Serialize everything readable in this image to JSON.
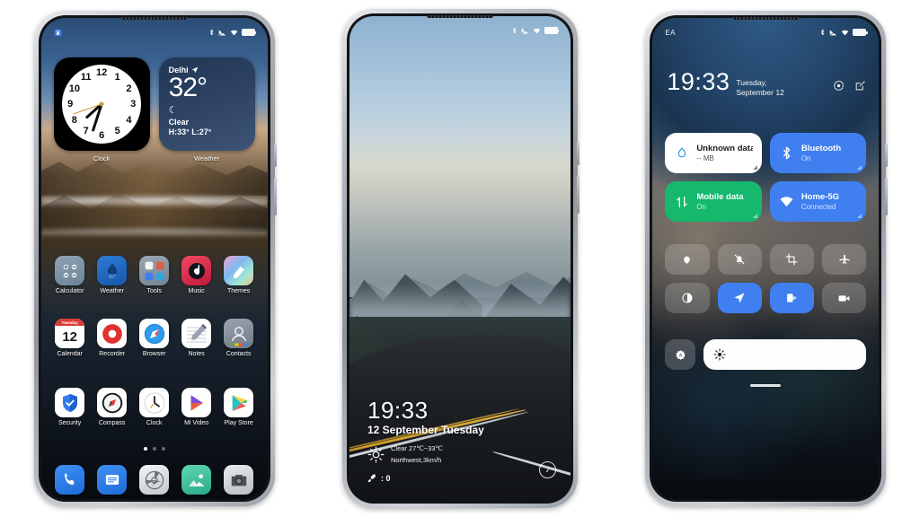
{
  "meta": {
    "scene": "Three smartphone mockups showing MIUI-style home screen, lock screen and control center"
  },
  "phone1": {
    "name": "home-screen",
    "statusbar": {
      "carrier": "",
      "icons": [
        "bluetooth-icon",
        "signal-icon",
        "wifi-icon",
        "battery-icon"
      ]
    },
    "widgets": [
      {
        "type": "clock",
        "label": "Clock",
        "numbers": [
          "12",
          "1",
          "2",
          "3",
          "4",
          "5",
          "6",
          "7",
          "8",
          "9",
          "10",
          "11"
        ],
        "hour_deg": 228,
        "minute_deg": 198,
        "second_deg": 251
      },
      {
        "type": "weather",
        "label": "Weather",
        "city": "Delhi",
        "temp": "32°",
        "condition": "Clear",
        "highlow": "H:33° L:27°",
        "moon_glyph": "☾"
      }
    ],
    "app_rows": [
      [
        {
          "label": "Calculator",
          "icon": "calculator-icon"
        },
        {
          "label": "Weather",
          "icon": "weather-icon"
        },
        {
          "label": "Tools",
          "icon": "tools-folder-icon"
        },
        {
          "label": "Music",
          "icon": "music-icon"
        },
        {
          "label": "Themes",
          "icon": "themes-icon"
        }
      ],
      [
        {
          "label": "Calendar",
          "icon": "calendar-icon",
          "day": "12",
          "weekday": "Tuesday"
        },
        {
          "label": "Recorder",
          "icon": "recorder-icon"
        },
        {
          "label": "Browser",
          "icon": "browser-icon"
        },
        {
          "label": "Notes",
          "icon": "notes-icon"
        },
        {
          "label": "Contacts",
          "icon": "contacts-icon"
        }
      ],
      [
        {
          "label": "Security",
          "icon": "security-icon"
        },
        {
          "label": "Compass",
          "icon": "compass-icon"
        },
        {
          "label": "Clock",
          "icon": "clock-app-icon"
        },
        {
          "label": "Mi Video",
          "icon": "mi-video-icon"
        },
        {
          "label": "Play Store",
          "icon": "play-store-icon"
        }
      ]
    ],
    "page_dots": {
      "count": 3,
      "active": 0
    },
    "dock": [
      {
        "label": "Phone",
        "icon": "phone-icon"
      },
      {
        "label": "Messages",
        "icon": "messages-icon"
      },
      {
        "label": "Settings",
        "icon": "settings-icon"
      },
      {
        "label": "Gallery",
        "icon": "gallery-icon"
      },
      {
        "label": "Camera",
        "icon": "camera-icon"
      }
    ]
  },
  "phone2": {
    "name": "lock-screen",
    "statusbar": {
      "icons": [
        "bluetooth-icon",
        "signal-icon",
        "wifi-icon",
        "battery-icon"
      ]
    },
    "time": "19:33",
    "date": "12 September Tuesday",
    "weather_line1": "Clear 27℃~33℃",
    "weather_line2": "Northwest,3km/h",
    "steps": ": 0",
    "music_glyph": "♪"
  },
  "phone3": {
    "name": "control-center",
    "statusbar": {
      "carrier": "EA",
      "icons": [
        "bluetooth-icon",
        "signal-icon",
        "wifi-icon",
        "battery-icon"
      ]
    },
    "time": "19:33",
    "date": "Tuesday, September 12",
    "actions": [
      {
        "name": "settings-gear-icon"
      },
      {
        "name": "edit-icon"
      }
    ],
    "tiles": [
      {
        "title": "Unknown data plan",
        "subtitle": "-- MB",
        "icon": "data-drop-icon",
        "style": "white"
      },
      {
        "title": "Bluetooth",
        "subtitle": "On",
        "icon": "bluetooth-icon",
        "style": "blue"
      },
      {
        "title": "Mobile data",
        "subtitle": "On",
        "icon": "mobile-data-icon",
        "style": "green"
      },
      {
        "title": "Home-5G",
        "subtitle": "Connected",
        "icon": "wifi-icon",
        "style": "blue"
      }
    ],
    "toggles": [
      {
        "name": "flashlight-toggle",
        "icon": "flashlight-icon",
        "on": false
      },
      {
        "name": "silent-toggle",
        "icon": "bell-muted-icon",
        "on": false
      },
      {
        "name": "screenshot-toggle",
        "icon": "crop-screenshot-icon",
        "on": false
      },
      {
        "name": "airplane-toggle",
        "icon": "airplane-icon",
        "on": false
      },
      {
        "name": "dark-mode-toggle",
        "icon": "dark-mode-icon",
        "on": false
      },
      {
        "name": "location-toggle",
        "icon": "location-arrow-icon",
        "on": true
      },
      {
        "name": "second-space-toggle",
        "icon": "second-space-icon",
        "on": true
      },
      {
        "name": "screen-recorder-toggle",
        "icon": "video-camera-icon",
        "on": false
      }
    ],
    "brightness": {
      "auto_label": "A",
      "auto_icon": "auto-brightness-icon",
      "slider_icon": "sun-brightness-icon",
      "level": 100
    }
  },
  "colors": {
    "accent_blue": "#3f7ff0",
    "accent_green": "#15b86c",
    "tile_white": "#ffffff"
  }
}
